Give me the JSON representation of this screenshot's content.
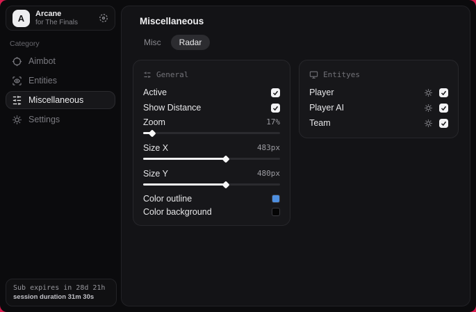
{
  "accent": {
    "window_border": "#d81b4e",
    "outline_swatch": "#4e8fe0",
    "background_swatch": "#050505"
  },
  "sidebar": {
    "brand": {
      "logo_letter": "A",
      "title": "Arcane",
      "subtitle": "for The Finals"
    },
    "category_label": "Category",
    "items": [
      {
        "label": "Aimbot",
        "icon": "crosshair-icon",
        "active": false
      },
      {
        "label": "Entities",
        "icon": "scan-eye-icon",
        "active": false
      },
      {
        "label": "Miscellaneous",
        "icon": "sliders-icon",
        "active": true
      },
      {
        "label": "Settings",
        "icon": "gear-icon",
        "active": false
      }
    ],
    "footer": {
      "line1": "Sub expires in 28d 21h",
      "line2": "session duration 31m 30s"
    }
  },
  "main": {
    "title": "Miscellaneous",
    "tabs": [
      {
        "label": "Misc",
        "active": false
      },
      {
        "label": "Radar",
        "active": true
      }
    ],
    "general_panel": {
      "header": "General",
      "toggles": [
        {
          "label": "Active",
          "checked": true
        },
        {
          "label": "Show Distance",
          "checked": true
        }
      ],
      "sliders": [
        {
          "label": "Zoom",
          "value": "17%",
          "fill": "6%"
        },
        {
          "label": "Size X",
          "value": "483px",
          "fill": "60%"
        },
        {
          "label": "Size Y",
          "value": "480px",
          "fill": "60%"
        }
      ],
      "colors": [
        {
          "label": "Color outline",
          "swatch": "#4e8fe0"
        },
        {
          "label": "Color background",
          "swatch": "#050505"
        }
      ]
    },
    "entities_panel": {
      "header": "Entityes",
      "rows": [
        {
          "label": "Player",
          "checked": true
        },
        {
          "label": "Player AI",
          "checked": true
        },
        {
          "label": "Team",
          "checked": true
        }
      ]
    }
  }
}
